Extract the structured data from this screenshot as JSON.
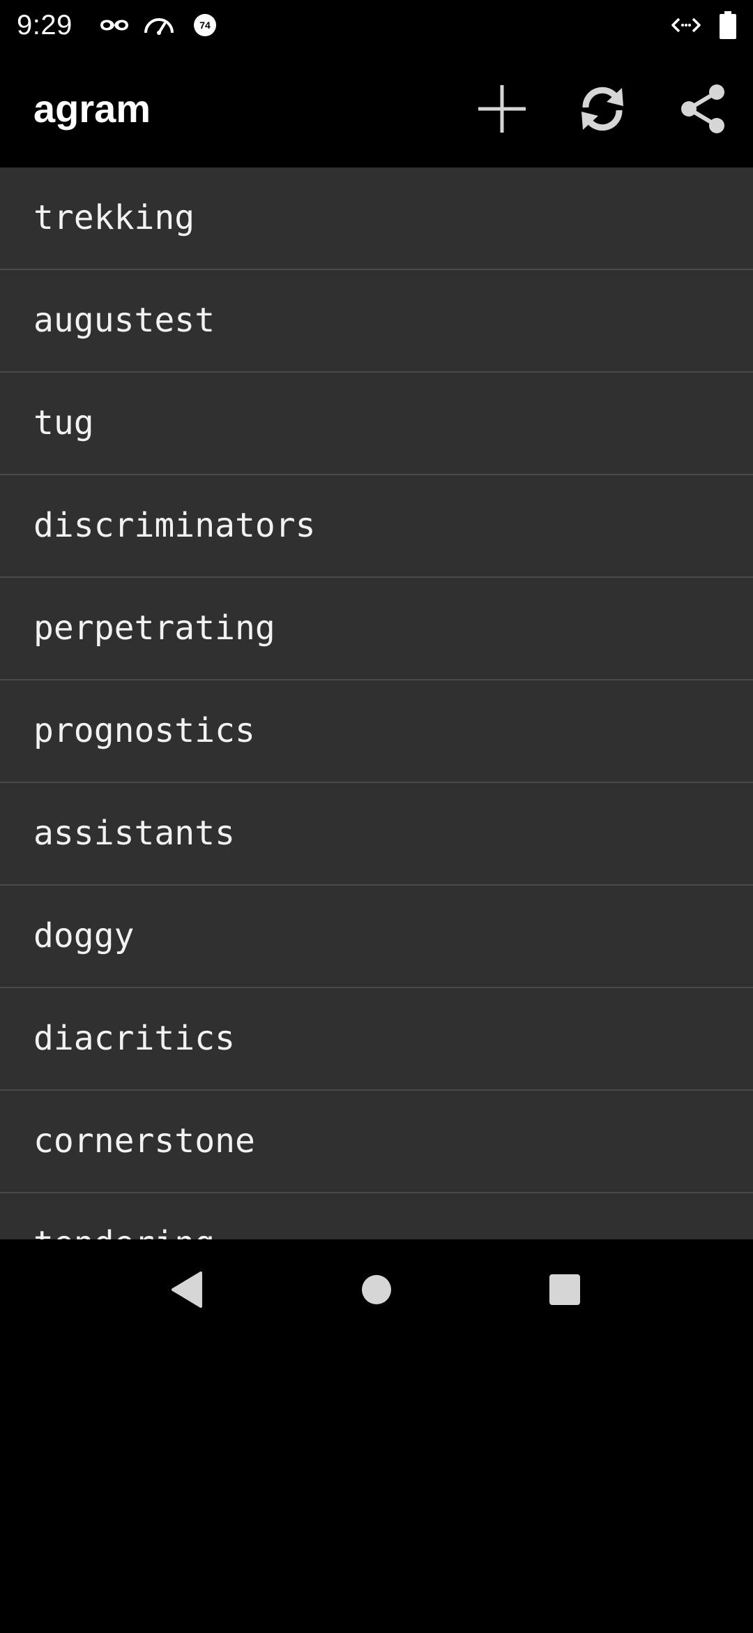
{
  "status_bar": {
    "time": "9:29",
    "icons": [
      "incognito-icon",
      "speedometer-icon",
      "notification-badge-icon",
      "code-arrows-icon",
      "battery-icon"
    ],
    "badge_text": "74"
  },
  "app_bar": {
    "title": "agram",
    "actions": [
      "add-icon",
      "refresh-icon",
      "share-icon"
    ]
  },
  "list": {
    "items": [
      "trekking",
      "augustest",
      "tug",
      "discriminators",
      "perpetrating",
      "prognostics",
      "assistants",
      "doggy",
      "diacritics",
      "cornerstone",
      "tendering"
    ]
  },
  "nav_bar": {
    "buttons": [
      "back-icon",
      "home-icon",
      "recents-icon"
    ]
  },
  "colors": {
    "background": "#000000",
    "list_background": "#303030",
    "divider": "#4a4a4a",
    "text": "#f2f2f2",
    "icon": "#d6d6d6"
  }
}
